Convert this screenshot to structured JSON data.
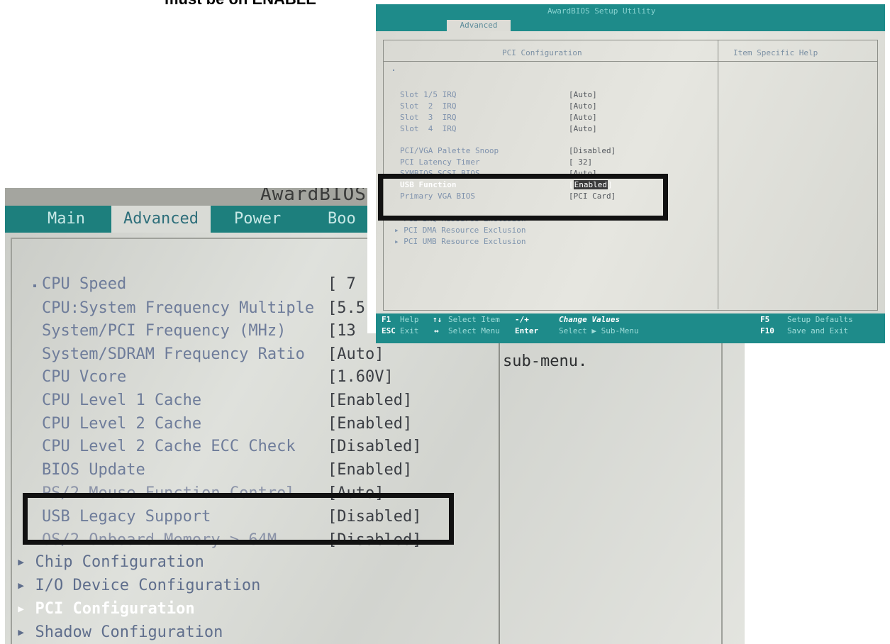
{
  "caption": "must be on ENABLE",
  "big_screen": {
    "brand": "AwardBIOS S",
    "tabs": [
      "Main",
      "Advanced",
      "Power",
      "Boo"
    ],
    "active_tab": "Advanced",
    "rows": [
      {
        "label": "CPU Speed",
        "value": "[ 7"
      },
      {
        "label": "CPU:System Frequency Multiple",
        "value": "[5.5"
      },
      {
        "label": "System/PCI Frequency (MHz)",
        "value": "[13"
      },
      {
        "label": "System/SDRAM Frequency Ratio",
        "value": "[Auto]"
      },
      {
        "label": "CPU Vcore",
        "value": "[1.60V]"
      },
      {
        "label": "CPU Level 1 Cache",
        "value": "[Enabled]"
      },
      {
        "label": "CPU Level 2 Cache",
        "value": "[Enabled]"
      },
      {
        "label": "CPU Level 2 Cache ECC Check",
        "value": "[Disabled]"
      },
      {
        "label": "BIOS Update",
        "value": "[Enabled]"
      },
      {
        "label": "PS/2 Mouse Function Control",
        "value": "[Auto]"
      },
      {
        "label": "USB Legacy Support",
        "value": "[Disabled]"
      },
      {
        "label": "OS/2 Onboard Memory > 64M",
        "value": "[Disabled]"
      }
    ],
    "submenus": [
      "Chip Configuration",
      "I/O Device Configuration",
      "PCI Configuration",
      "Shadow Configuration"
    ],
    "help_text": "sub-menu."
  },
  "small_screen": {
    "title": "AwardBIOS Setup Utility",
    "tab": "Advanced",
    "section_title": "PCI Configuration",
    "help_title": "Item Specific Help",
    "rows": [
      {
        "label": "Slot 1/5 IRQ",
        "value": "[Auto]"
      },
      {
        "label": "Slot  2  IRQ",
        "value": "[Auto]"
      },
      {
        "label": "Slot  3  IRQ",
        "value": "[Auto]"
      },
      {
        "label": "Slot  4  IRQ",
        "value": "[Auto]"
      },
      {
        "label": "PCI/VGA Palette Snoop",
        "value": "[Disabled]"
      },
      {
        "label": "PCI Latency Timer",
        "value": "[ 32]"
      },
      {
        "label": "SYMBIOS SCSI BIOS",
        "value": "[Auto]"
      },
      {
        "label": "USB Function",
        "value": "Enabled"
      },
      {
        "label": "Primary VGA BIOS",
        "value": "[PCI Card]"
      }
    ],
    "submenus": [
      "PCI IRQ Resource Exclusion",
      "PCI DMA Resource Exclusion",
      "PCI UMB Resource Exclusion"
    ],
    "status": {
      "f1_key": "F1",
      "f1_label": "Help",
      "ud_arrows": "↑↓",
      "select_item": "Select Item",
      "pm_key": "-/+",
      "change_values": "Change Values",
      "f5_key": "F5",
      "setup_defaults": "Setup Defaults",
      "esc_key": "ESC",
      "esc_label": "Exit",
      "lr_arrows": "↔",
      "select_menu": "Select Menu",
      "enter_key": "Enter",
      "select_submenu": "Select ▶ Sub-Menu",
      "f10_key": "F10",
      "save_exit": "Save and Exit"
    }
  }
}
